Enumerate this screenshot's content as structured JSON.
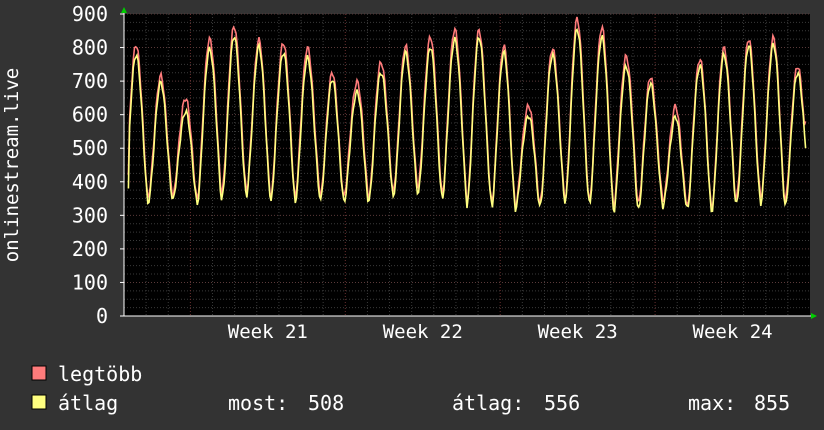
{
  "chart_data": {
    "type": "line",
    "ylabel": "onlinestream.live",
    "ylim": [
      0,
      900
    ],
    "yticks": [
      0,
      100,
      200,
      300,
      400,
      500,
      600,
      700,
      800,
      900
    ],
    "xticks": [
      "Week 21",
      "Week 22",
      "Week 23",
      "Week 24"
    ],
    "grid": true,
    "x_days": 31,
    "series": [
      {
        "name": "legtöbb",
        "color": "#ff7b7b",
        "daily_peaks": [
          810,
          710,
          650,
          830,
          860,
          820,
          820,
          800,
          720,
          700,
          760,
          800,
          830,
          860,
          850,
          800,
          630,
          800,
          880,
          860,
          780,
          710,
          620,
          770,
          800,
          820,
          830,
          750
        ],
        "daily_troughs": [
          330,
          360,
          350,
          360,
          370,
          360,
          350,
          370,
          340,
          360,
          360,
          380,
          370,
          360,
          340,
          320,
          330,
          350,
          340,
          330,
          330,
          340,
          330,
          320,
          330,
          350,
          340,
          350
        ],
        "ends": [
          420,
          580
        ]
      },
      {
        "name": "átlag",
        "color": "#ffff80",
        "daily_peaks": [
          780,
          690,
          610,
          800,
          830,
          800,
          790,
          770,
          700,
          670,
          730,
          780,
          800,
          830,
          830,
          780,
          600,
          780,
          850,
          830,
          750,
          690,
          590,
          750,
          780,
          800,
          810,
          730
        ],
        "daily_troughs": [
          320,
          340,
          340,
          340,
          350,
          350,
          340,
          350,
          330,
          340,
          350,
          360,
          350,
          350,
          330,
          310,
          320,
          340,
          330,
          320,
          310,
          320,
          320,
          310,
          320,
          330,
          330,
          330
        ],
        "ends": [
          380,
          500
        ]
      }
    ]
  },
  "legend": {
    "items": [
      {
        "label": "legtöbb",
        "color": "#ff7b7b"
      },
      {
        "label": "átlag",
        "color": "#ffff80"
      }
    ],
    "stats": {
      "now_label": "most:",
      "now_value": "508",
      "avg_label": "átlag:",
      "avg_value": "556",
      "max_label": "max:",
      "max_value": "855"
    }
  }
}
